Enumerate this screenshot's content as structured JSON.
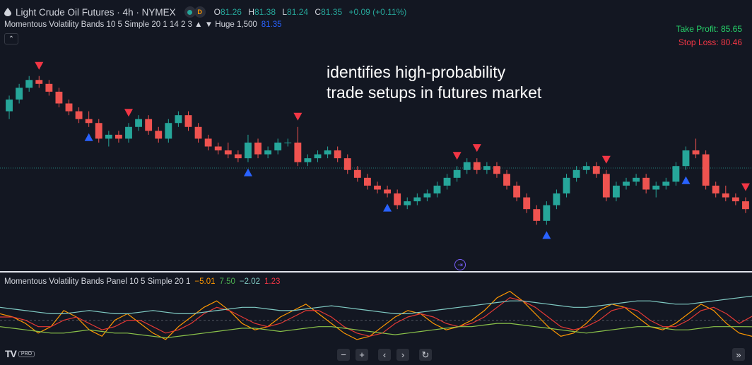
{
  "header": {
    "symbol_title": "Light Crude Oil Futures · 4h · NYMEX",
    "badge_d": "D",
    "ohlc": {
      "o_label": "O",
      "o": "81.26",
      "h_label": "H",
      "h": "81.38",
      "l_label": "L",
      "l": "81.24",
      "c_label": "C",
      "c": "81.35",
      "change": "+0.09 (+0.11%)"
    }
  },
  "indicator_main": {
    "label": "Momentous Volatility Bands 10 5 Simple 20 1 14 2 3 ▲ ▼ Huge 1,500",
    "value": "81.35"
  },
  "collapse_icon": "⌃",
  "take_profit": "Take Profit: 85.65",
  "stop_loss": "Stop Loss: 80.46",
  "annotation": {
    "line1": "identifies high-probability",
    "line2": "trade setups in futures market"
  },
  "indicator_panel": {
    "label": "Momentous Volatility Bands Panel 10 5 Simple 20 1",
    "v1": "−5.01",
    "v2": "7.50",
    "v3": "−2.02",
    "v4": "1.23"
  },
  "nav": {
    "zoom_out": "−",
    "zoom_in": "+",
    "left": "‹",
    "right": "›",
    "reset": "↻"
  },
  "logo": {
    "tv": "TV",
    "pro": "PRO"
  },
  "goto_label": "»",
  "colors": {
    "background": "#131722",
    "up": "#26a69a",
    "down": "#ef5350",
    "buy_marker": "#2962ff",
    "sell_marker": "#f23645",
    "line_orange": "#ff9800",
    "line_red": "#e53935",
    "line_teal": "#80cbc4",
    "line_green": "#8bc34a"
  },
  "chart_data": {
    "type": "candlestick",
    "timeframe": "4h",
    "price_range": [
      79.6,
      84.2
    ],
    "last_price": 81.35,
    "ohlc": [
      [
        82.8,
        83.2,
        82.6,
        83.1
      ],
      [
        83.1,
        83.5,
        83.0,
        83.4
      ],
      [
        83.4,
        83.7,
        83.3,
        83.6
      ],
      [
        83.6,
        83.7,
        83.4,
        83.5
      ],
      [
        83.5,
        83.6,
        83.2,
        83.3
      ],
      [
        83.3,
        83.4,
        82.9,
        83.0
      ],
      [
        83.0,
        83.1,
        82.7,
        82.8
      ],
      [
        82.8,
        82.9,
        82.5,
        82.6
      ],
      [
        82.6,
        82.8,
        82.4,
        82.5
      ],
      [
        82.5,
        82.6,
        82.0,
        82.1
      ],
      [
        82.1,
        82.3,
        81.9,
        82.2
      ],
      [
        82.2,
        82.3,
        82.0,
        82.1
      ],
      [
        82.1,
        82.5,
        82.0,
        82.4
      ],
      [
        82.4,
        82.7,
        82.3,
        82.6
      ],
      [
        82.6,
        82.7,
        82.2,
        82.3
      ],
      [
        82.3,
        82.4,
        82.0,
        82.1
      ],
      [
        82.1,
        82.6,
        82.0,
        82.5
      ],
      [
        82.5,
        82.8,
        82.4,
        82.7
      ],
      [
        82.7,
        82.8,
        82.3,
        82.4
      ],
      [
        82.4,
        82.5,
        82.0,
        82.1
      ],
      [
        82.1,
        82.2,
        81.8,
        81.9
      ],
      [
        81.9,
        82.0,
        81.7,
        81.8
      ],
      [
        81.8,
        82.0,
        81.6,
        81.7
      ],
      [
        81.7,
        81.8,
        81.5,
        81.6
      ],
      [
        81.6,
        82.2,
        81.5,
        82.0
      ],
      [
        82.0,
        82.1,
        81.6,
        81.7
      ],
      [
        81.7,
        81.9,
        81.6,
        81.8
      ],
      [
        81.8,
        82.1,
        81.7,
        82.0
      ],
      [
        82.0,
        82.1,
        81.9,
        82.0
      ],
      [
        82.0,
        82.4,
        81.4,
        81.5
      ],
      [
        81.5,
        81.7,
        81.4,
        81.6
      ],
      [
        81.6,
        81.8,
        81.5,
        81.7
      ],
      [
        81.7,
        81.9,
        81.6,
        81.8
      ],
      [
        81.8,
        81.9,
        81.5,
        81.6
      ],
      [
        81.6,
        81.7,
        81.2,
        81.3
      ],
      [
        81.3,
        81.4,
        81.0,
        81.1
      ],
      [
        81.1,
        81.2,
        80.8,
        80.9
      ],
      [
        80.9,
        81.0,
        80.7,
        80.8
      ],
      [
        80.8,
        80.9,
        80.6,
        80.7
      ],
      [
        80.7,
        80.8,
        80.3,
        80.4
      ],
      [
        80.4,
        80.6,
        80.3,
        80.5
      ],
      [
        80.5,
        80.7,
        80.4,
        80.6
      ],
      [
        80.6,
        80.8,
        80.5,
        80.7
      ],
      [
        80.7,
        81.0,
        80.6,
        80.9
      ],
      [
        80.9,
        81.2,
        80.8,
        81.1
      ],
      [
        81.1,
        81.4,
        81.0,
        81.3
      ],
      [
        81.3,
        81.6,
        81.2,
        81.5
      ],
      [
        81.5,
        81.6,
        81.2,
        81.3
      ],
      [
        81.3,
        81.5,
        81.2,
        81.4
      ],
      [
        81.4,
        81.5,
        81.1,
        81.2
      ],
      [
        81.2,
        81.3,
        80.8,
        80.9
      ],
      [
        80.9,
        81.0,
        80.5,
        80.6
      ],
      [
        80.6,
        80.7,
        80.2,
        80.3
      ],
      [
        80.3,
        80.4,
        79.9,
        80.0
      ],
      [
        80.0,
        80.5,
        79.9,
        80.4
      ],
      [
        80.4,
        80.8,
        80.3,
        80.7
      ],
      [
        80.7,
        81.2,
        80.6,
        81.1
      ],
      [
        81.1,
        81.4,
        81.0,
        81.3
      ],
      [
        81.3,
        81.5,
        81.2,
        81.4
      ],
      [
        81.4,
        81.5,
        81.1,
        81.2
      ],
      [
        81.2,
        81.3,
        80.5,
        80.6
      ],
      [
        80.6,
        81.0,
        80.5,
        80.9
      ],
      [
        80.9,
        81.1,
        80.8,
        81.0
      ],
      [
        81.0,
        81.2,
        80.9,
        81.1
      ],
      [
        81.1,
        81.2,
        80.7,
        80.8
      ],
      [
        80.8,
        81.0,
        80.6,
        80.9
      ],
      [
        80.9,
        81.1,
        80.8,
        81.0
      ],
      [
        81.0,
        81.5,
        80.9,
        81.4
      ],
      [
        81.4,
        81.9,
        81.3,
        81.8
      ],
      [
        81.8,
        82.1,
        81.6,
        81.7
      ],
      [
        81.7,
        81.8,
        80.8,
        80.9
      ],
      [
        80.9,
        81.0,
        80.6,
        80.7
      ],
      [
        80.7,
        80.9,
        80.5,
        80.6
      ],
      [
        80.6,
        80.7,
        80.4,
        80.5
      ],
      [
        80.5,
        80.6,
        80.2,
        80.3
      ]
    ],
    "buy_signals": [
      8,
      24,
      38,
      54,
      68
    ],
    "sell_signals": [
      3,
      12,
      29,
      45,
      47,
      60,
      74
    ],
    "panel": {
      "range": [
        -8,
        10
      ],
      "series": [
        {
          "color": "#ff9800",
          "values": [
            2,
            1,
            -1,
            -4,
            -2,
            3,
            1,
            -3,
            -5,
            0,
            2,
            -1,
            -4,
            -6,
            -2,
            1,
            4,
            6,
            3,
            -1,
            -3,
            -2,
            1,
            3,
            5,
            2,
            -1,
            -4,
            -6,
            -5,
            -2,
            1,
            3,
            2,
            -1,
            -3,
            -2,
            0,
            3,
            7,
            9,
            6,
            2,
            -2,
            -5,
            -4,
            -1,
            3,
            5,
            4,
            1,
            -2,
            -3,
            -1,
            2,
            5,
            3,
            -1,
            -4,
            -5.01
          ]
        },
        {
          "color": "#e53935",
          "values": [
            1,
            1,
            0,
            -2,
            -2,
            0,
            1,
            -1,
            -3,
            -2,
            0,
            0,
            -2,
            -4,
            -3,
            -1,
            2,
            4,
            3,
            1,
            -1,
            -2,
            -1,
            1,
            3,
            3,
            1,
            -2,
            -4,
            -5,
            -4,
            -1,
            1,
            2,
            1,
            -1,
            -2,
            -1,
            1,
            4,
            7,
            6,
            4,
            1,
            -2,
            -3,
            -2,
            0,
            3,
            4,
            3,
            0,
            -2,
            -2,
            0,
            3,
            4,
            2,
            -1,
            1.23
          ]
        },
        {
          "color": "#80cbc4",
          "values": [
            4,
            3.5,
            3,
            2.5,
            2,
            2,
            2.5,
            3,
            2.5,
            2,
            2,
            2.5,
            3,
            2.5,
            2,
            2,
            2.5,
            3,
            3.5,
            4,
            4,
            3.5,
            3,
            3,
            3.5,
            4,
            4.5,
            4,
            3.5,
            3,
            2.5,
            2,
            2,
            2.5,
            3,
            3.5,
            4,
            4.5,
            5,
            5.5,
            6,
            6,
            5.5,
            5,
            4.5,
            4,
            4,
            4.5,
            5,
            5.5,
            6,
            6,
            5.5,
            5,
            5,
            5.5,
            6,
            6.5,
            7,
            7.5
          ]
        },
        {
          "color": "#8bc34a",
          "values": [
            -2,
            -2.5,
            -3,
            -3.5,
            -4,
            -4,
            -3.5,
            -3,
            -3.5,
            -4,
            -4,
            -4.5,
            -5,
            -5.5,
            -5,
            -4.5,
            -4,
            -3.5,
            -3,
            -2.5,
            -2.5,
            -3,
            -3.5,
            -3,
            -2.5,
            -2,
            -2,
            -2.5,
            -3,
            -3.5,
            -4,
            -4.5,
            -4,
            -3.5,
            -3,
            -2.5,
            -2,
            -2,
            -1.5,
            -1,
            -1,
            -1.5,
            -2,
            -2.5,
            -3,
            -3.5,
            -4,
            -3.5,
            -3,
            -2.5,
            -2,
            -2,
            -2.5,
            -3,
            -3,
            -2.5,
            -2,
            -2,
            -2,
            -2.02
          ]
        }
      ]
    }
  }
}
